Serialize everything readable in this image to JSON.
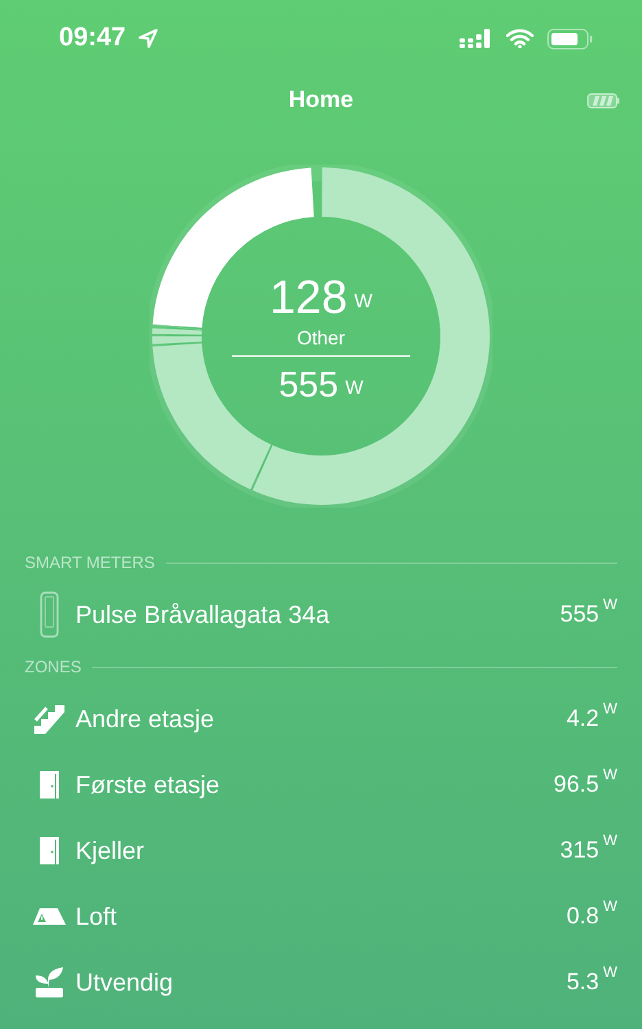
{
  "status_bar": {
    "time": "09:47"
  },
  "header": {
    "title": "Home"
  },
  "donut": {
    "center_value": "128",
    "center_unit": "W",
    "center_label": "Other",
    "total_value": "555",
    "total_unit": "W"
  },
  "sections": [
    {
      "title": "SMART METERS",
      "rows": [
        {
          "kind": "meter",
          "name": "Pulse Bråvallagata 34a",
          "value": "555",
          "unit": "W"
        }
      ]
    },
    {
      "title": "ZONES",
      "rows": [
        {
          "kind": "stairs",
          "name": "Andre etasje",
          "value": "4.2",
          "unit": "W"
        },
        {
          "kind": "door",
          "name": "Første etasje",
          "value": "96.5",
          "unit": "W"
        },
        {
          "kind": "door",
          "name": "Kjeller",
          "value": "315",
          "unit": "W"
        },
        {
          "kind": "attic",
          "name": "Loft",
          "value": "0.8",
          "unit": "W"
        },
        {
          "kind": "plant",
          "name": "Utvendig",
          "value": "5.3",
          "unit": "W"
        }
      ]
    }
  ]
}
